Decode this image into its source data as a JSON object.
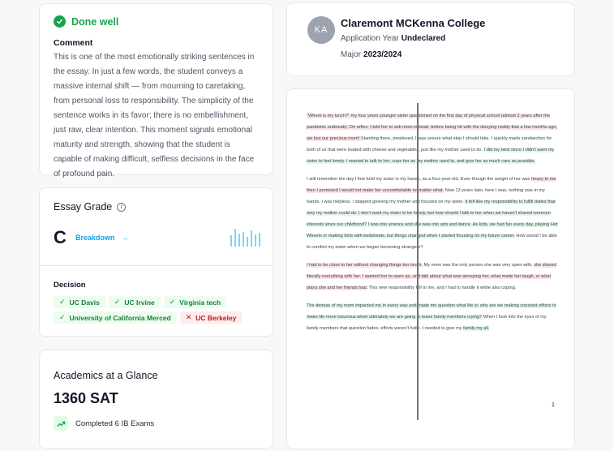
{
  "done": {
    "title": "Done well",
    "comment_label": "Comment",
    "comment_text": "This is one of the most emotionally striking sentences in the essay. In just a few words, the student conveys a massive internal shift — from mourning to caretaking, from personal loss to responsibility. The simplicity of the sentence works in its favor; there is no embellishment, just raw, clear intention. This moment signals emotional maturity and strength, showing that the student is capable of making difficult, selfless decisions in the face of profound pain."
  },
  "grade": {
    "title": "Essay Grade",
    "letter": "C",
    "breakdown_label": "Breakdown",
    "arrow": "→",
    "decision_label": "Decision",
    "decisions": [
      {
        "label": "UC Davis",
        "status": "accepted",
        "mark": "✓"
      },
      {
        "label": "UC Irvine",
        "status": "accepted",
        "mark": "✓"
      },
      {
        "label": "Virginia tech",
        "status": "accepted",
        "mark": "✓"
      },
      {
        "label": "University of California Merced",
        "status": "accepted",
        "mark": "✓"
      },
      {
        "label": "UC Berkeley",
        "status": "rejected",
        "mark": "✕"
      }
    ]
  },
  "academics": {
    "title": "Academics at a Glance",
    "score": "1360 SAT",
    "exams": "Completed 6 IB Exams"
  },
  "profile": {
    "initials": "KA",
    "college": "Claremont MCKenna College",
    "app_year_label": "Application Year",
    "app_year_value": "Undeclared",
    "major_label": "Major",
    "major_value": "2023/2024"
  },
  "essay": {
    "page_number": "1",
    "p1": {
      "red": "\"Where is my lunch?\" my four years younger sister questioned on the first day of physical school (almost 2 years after the pandemic outbreak). On reflex, I told her to ask mom instead, before being hit with the dizzying reality that a few months ago, we lost our precious mom! ",
      "rest": "Standing there, perplexed, I was unsure what step I should take. I quickly made sandwiches for both of us that were loaded with cheese and vegetables, just like my mother used to do. ",
      "green": "I did my best since I didn't want my sister to feel lonely. I wanted to talk to her, coax her as my mother used to, and give her as much care as possible."
    },
    "p2": {
      "plain1": "I still remember the day I first held my sister in my hands, as a four-year-old. Even though the weight of her was ",
      "red": "heavy to me then I promised I would not make her uncomfortable no matter what.",
      "plain2": " Now 13 years later, here I was, nothing was in my hands. I was helpless. I stopped grieving my mother and focused on my sister. ",
      "green": "It felt like my responsibility to fulfill duties that only my mother could do. I don't want my sister to be lonely, but how should I talk to her when we haven't shared common interests since our childhood? I was into science and she was into arts and dance. As kids, we had fun every day, playing Hot Wheels or making forts with bedsheets, but things changed when I started focusing on my future career.",
      "plain3": " How would I be able to comfort my sister when we began becoming strangers?"
    },
    "p3": {
      "red": "I had to be close to her without changing things too much.",
      "plain1": " My mom was the only person she was very open with, ",
      "red2": "she shared literally everything with her. I wanted her to open up, and talk about what was annoying her, what made her laugh, or what plans she and her friends had.",
      "plain2": " This new responsibility fell to me, and I had to handle it while also coping."
    },
    "p4": {
      "green": "The demise of my mom impacted me in every way and made me question what life is: why are we making constant efforts to make life more luxurious when ultimately we are going to leave family members crying?",
      "plain": " When I look into the eyes of my family members that question fades; efforts weren't futile. I needed to give my ",
      "green2": "family my all."
    }
  }
}
